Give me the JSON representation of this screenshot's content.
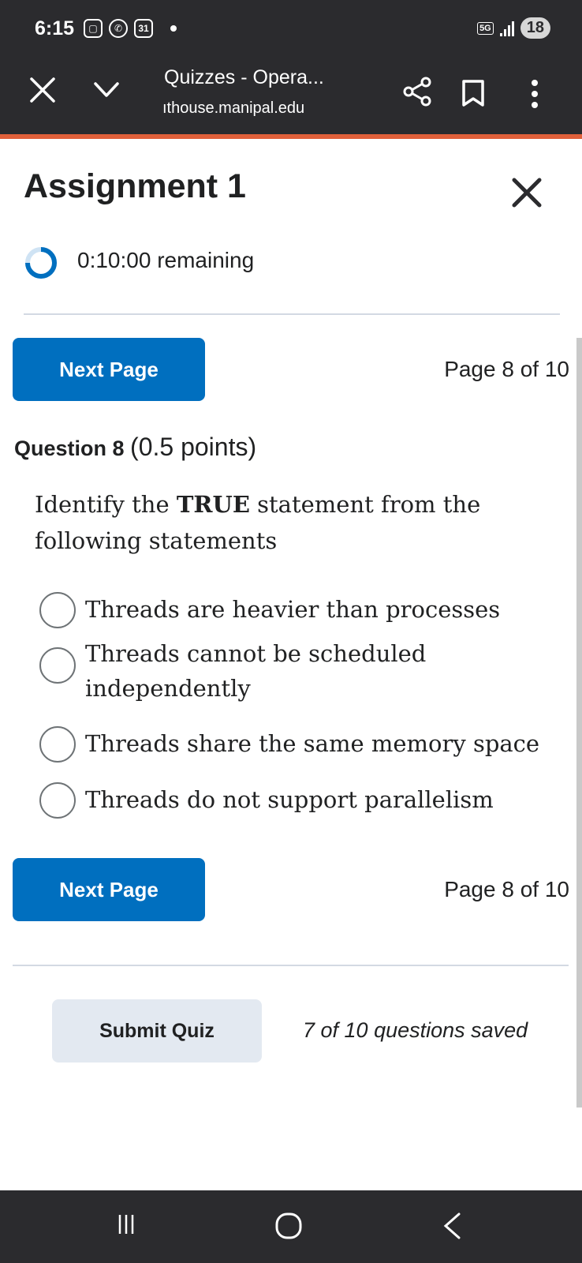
{
  "status_bar": {
    "time": "6:15",
    "calendar_date": "31",
    "network": "5G",
    "battery": "18",
    "icons": [
      "screenshot-icon",
      "whatsapp-icon",
      "calendar-icon",
      "notification-dot",
      "signal-icon",
      "battery-icon"
    ]
  },
  "browser": {
    "page_title": "Quizzes - Opera...",
    "url": "ıthouse.manipal.edu",
    "icons": [
      "close-icon",
      "chevron-down-icon",
      "share-icon",
      "bookmark-icon",
      "more-vert-icon"
    ],
    "accent_color": "#e0603a"
  },
  "quiz": {
    "title": "Assignment 1",
    "timer": "0:10:00 remaining",
    "next_page_label": "Next Page",
    "page_indicator": "Page 8 of 10",
    "question_label": "Question 8",
    "question_points": "(0.5 points)",
    "question_text_1": "Identify the ",
    "question_text_bold": "TRUE",
    "question_text_2": " statement from the following statements",
    "options": [
      "Threads are heavier than processes",
      "Threads cannot be scheduled independently",
      "Threads share the same memory space",
      "Threads do not support parallelism"
    ],
    "submit_label": "Submit Quiz",
    "saved_status": "7 of 10 questions saved",
    "primary_color": "#006fbf"
  },
  "nav_bar": {
    "icons": [
      "recents-icon",
      "home-icon",
      "back-icon"
    ]
  }
}
